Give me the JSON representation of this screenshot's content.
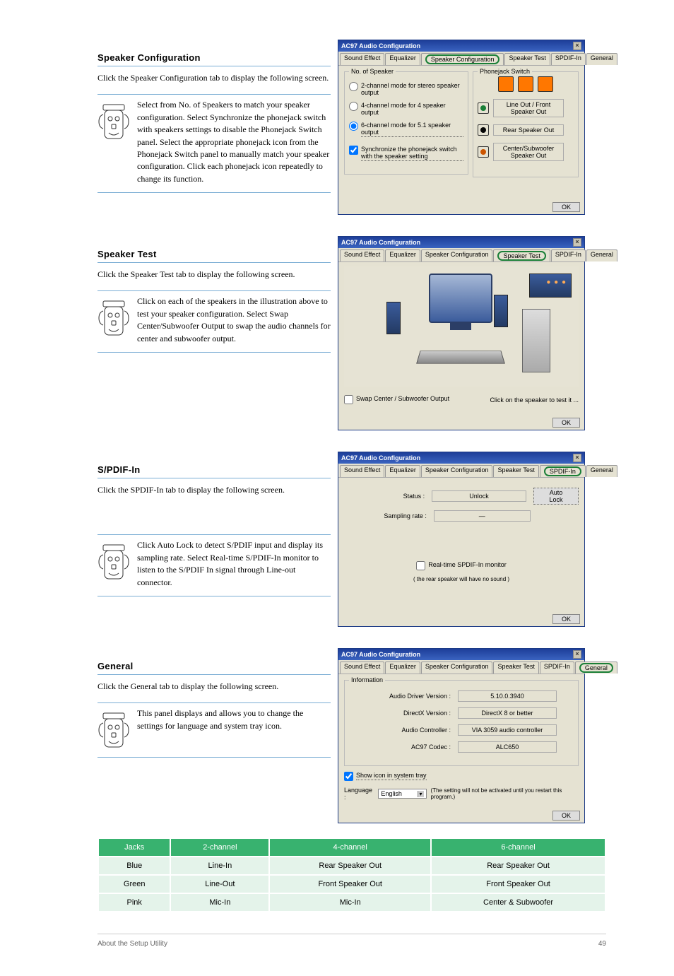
{
  "sections": {
    "speakerConfig": {
      "title": "Speaker Configuration",
      "body": "Click the Speaker Configuration tab to display the following screen."
    },
    "speakerTest": {
      "title": "Speaker Test",
      "body": "Click the Speaker Test tab to display the following screen."
    },
    "spdifIn": {
      "title": "S/PDIF-In",
      "body": "Click the SPDIF-In tab to display the following screen."
    },
    "general": {
      "title": "General",
      "body": "Click the General tab to display the following screen."
    }
  },
  "notes": {
    "cfg": "Select from No. of Speakers to match your speaker configuration. Select Synchronize the phonejack switch with speakers settings to disable the Phonejack Switch panel. Select the appropriate phonejack icon from the Phonejack Switch panel to manually match your speaker configuration. Click each phonejack icon repeatedly to change its function.",
    "test": "Click on each of the speakers in the illustration above to test your speaker configuration. Select Swap Center/Subwoofer Output to swap the audio channels for center and subwoofer output.",
    "spdif": "Click Auto Lock to detect S/PDIF input and display its sampling rate. Select Real-time S/PDIF-In monitor to listen to the S/PDIF In signal through Line-out connector.",
    "general": "This panel displays and allows you to change the settings for language and system tray icon."
  },
  "dialog": {
    "title": "AC97 Audio Configuration",
    "close": "×",
    "tabs": {
      "soundEffect": "Sound Effect",
      "equalizer": "Equalizer",
      "speakerConfiguration": "Speaker Configuration",
      "speakerTest": "Speaker Test",
      "spdifIn": "SPDIF-In",
      "general": "General"
    },
    "ok": "OK",
    "cfg": {
      "groupLeft": "No. of Speaker",
      "groupRight": "Phonejack Switch",
      "r1": "2-channel mode for stereo speaker output",
      "r2": "4-channel mode for 4 speaker output",
      "r3": "6-channel mode for 5.1 speaker output",
      "sync": "Synchronize the phonejack switch with the speaker setting",
      "j1": "Line Out / Front Speaker Out",
      "j2": "Rear Speaker Out",
      "j3": "Center/Subwoofer Speaker Out"
    },
    "test": {
      "swap": "Swap Center / Subwoofer Output",
      "hint": "Click on the speaker to test it ..."
    },
    "spdif": {
      "statusLabel": "Status :",
      "statusValue": "Unlock",
      "autoLock": "Auto Lock",
      "samplingLabel": "Sampling rate :",
      "samplingValue": "—",
      "realtime": "Real-time SPDIF-In monitor",
      "realtimeSub": "( the rear speaker will have no sound )"
    },
    "general": {
      "groupTitle": "Information",
      "audioDriverLabel": "Audio Driver Version :",
      "audioDriverValue": "5.10.0.3940",
      "directXLabel": "DirectX Version :",
      "directXValue": "DirectX 8 or better",
      "audioControllerLabel": "Audio Controller :",
      "audioControllerValue": "VIA 3059 audio controller",
      "codecLabel": "AC97 Codec :",
      "codecValue": "ALC650",
      "showIcon": "Show icon in system tray",
      "languageLabel": "Language :",
      "languageValue": "English",
      "languageNote": "(The setting will not be activated until you restart this program.)"
    }
  },
  "table": {
    "headers": [
      "Jacks",
      "2-channel",
      "4-channel",
      "6-channel"
    ],
    "rows": [
      [
        "Blue",
        "Line-In",
        "Rear Speaker Out",
        "Rear Speaker Out"
      ],
      [
        "Green",
        "Line-Out",
        "Front Speaker Out",
        "Front Speaker Out"
      ],
      [
        "Pink",
        "Mic-In",
        "Mic-In",
        "Center & Subwoofer"
      ]
    ]
  },
  "footer": {
    "left": "About the Setup Utility",
    "right": "49"
  }
}
